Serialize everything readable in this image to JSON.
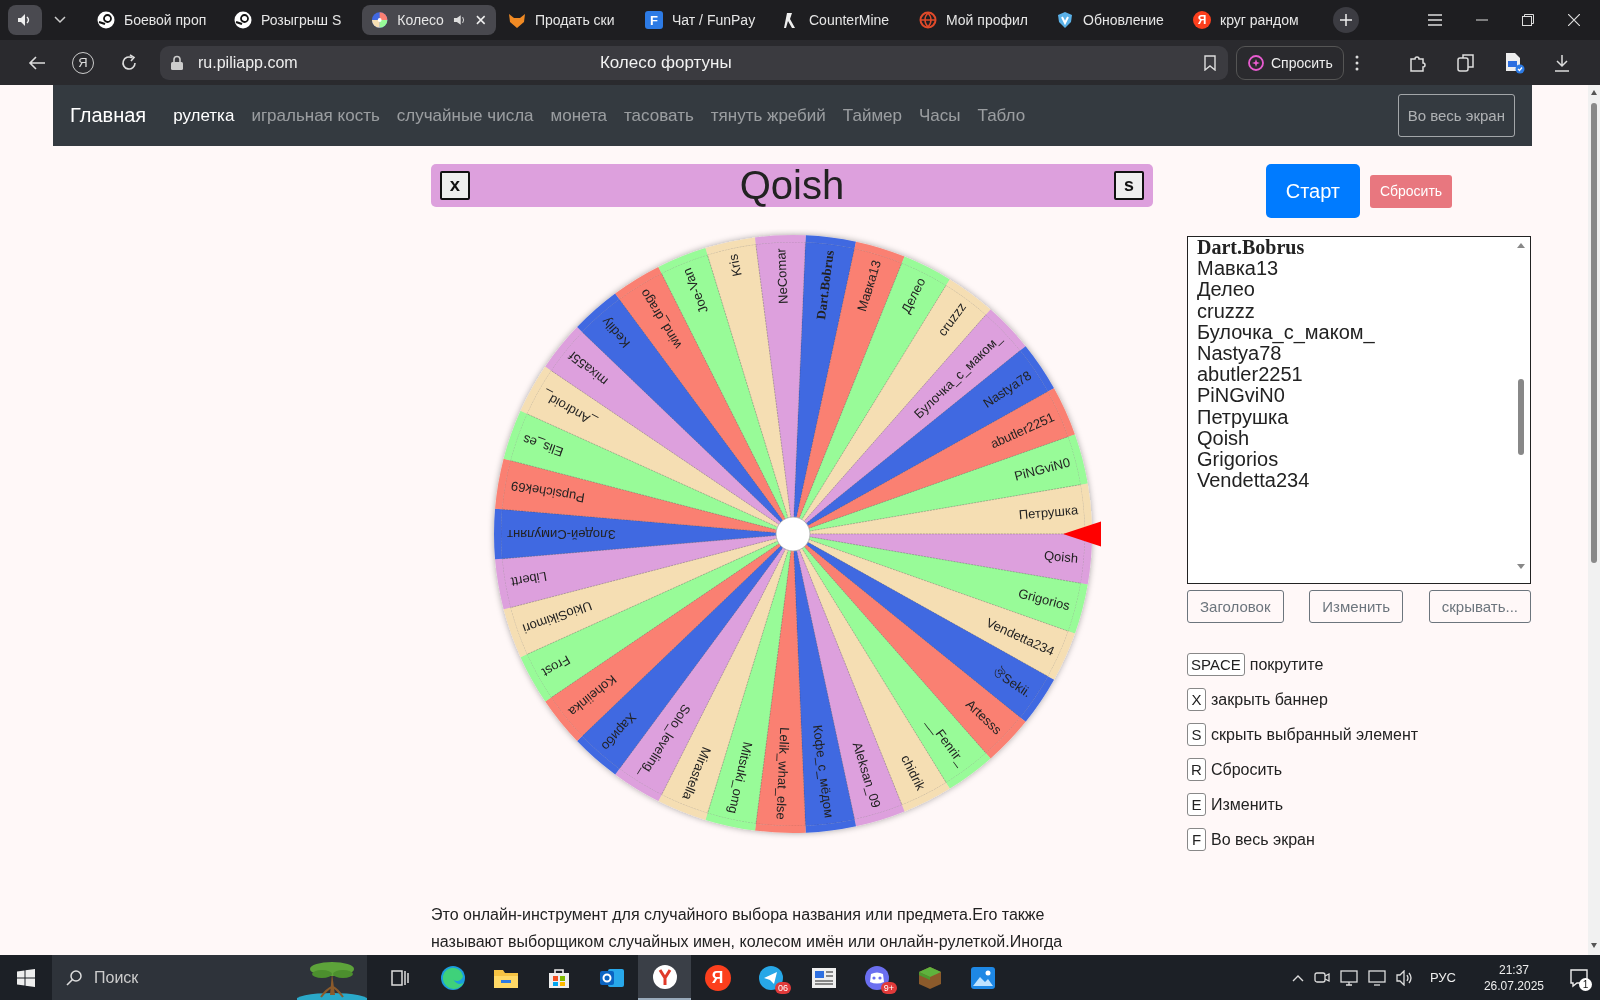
{
  "browser": {
    "tabs": [
      {
        "title": "Боевой проп",
        "kind": "steam",
        "selected": false
      },
      {
        "title": "Розыгрыш S",
        "kind": "steam",
        "selected": false
      },
      {
        "title": "Колесо",
        "kind": "wheel",
        "selected": true
      },
      {
        "title": "Продать ски",
        "kind": "fox",
        "selected": false
      },
      {
        "title": "Чат / FunPay",
        "kind": "letter",
        "icon_text": "F",
        "selected": false
      },
      {
        "title": "CounterMine",
        "kind": "counter",
        "selected": false
      },
      {
        "title": "Мой профил",
        "kind": "globe",
        "selected": false
      },
      {
        "title": "Обновление",
        "kind": "shield",
        "selected": false
      },
      {
        "title": "круг рандом",
        "kind": "letter-round",
        "icon_text": "Я",
        "selected": false
      }
    ],
    "yandex_button": "Я",
    "url": "ru.piliapp.com",
    "page_title": "Колесо фортуны",
    "ask_button": "Спросить"
  },
  "nav": {
    "brand": "Главная",
    "items": [
      {
        "label": "рулетка",
        "selected": true
      },
      {
        "label": "игральная кость",
        "selected": false
      },
      {
        "label": "случайные числа",
        "selected": false
      },
      {
        "label": "монета",
        "selected": false
      },
      {
        "label": "тасовать",
        "selected": false
      },
      {
        "label": "тянуть жребий",
        "selected": false
      },
      {
        "label": "Таймер",
        "selected": false
      },
      {
        "label": "Часы",
        "selected": false
      },
      {
        "label": "Табло",
        "selected": false
      }
    ],
    "fullscreen_button": "Во весь экран"
  },
  "banner": {
    "close_key": "x",
    "title": "Qoish",
    "hide_key": "s"
  },
  "wheel": {
    "segments": [
      {
        "label": "Dart.Bobrus",
        "color": "#4169e1",
        "bold": true
      },
      {
        "label": "Мавка13",
        "color": "#fa8072",
        "bold": false
      },
      {
        "label": "Делео",
        "color": "#98fb98",
        "bold": false
      },
      {
        "label": "cruzzz",
        "color": "#f5deb3",
        "bold": false
      },
      {
        "label": "Булочка_с_маком_",
        "color": "#dda0dd",
        "bold": false
      },
      {
        "label": "Nastya78",
        "color": "#4169e1",
        "bold": false
      },
      {
        "label": "abutler2251",
        "color": "#fa8072",
        "bold": false
      },
      {
        "label": "PiNGviN0",
        "color": "#98fb98",
        "bold": false
      },
      {
        "label": "Петрушка",
        "color": "#f5deb3",
        "bold": false
      },
      {
        "label": "Qoish",
        "color": "#dda0dd",
        "bold": false
      },
      {
        "label": "Grigorios",
        "color": "#98fb98",
        "bold": false
      },
      {
        "label": "Vendetta234",
        "color": "#f5deb3",
        "bold": false
      },
      {
        "label": "ঔSekii.",
        "color": "#4169e1",
        "bold": false
      },
      {
        "label": "Artesss",
        "color": "#fa8072",
        "bold": false
      },
      {
        "label": "__Fenrir_",
        "color": "#98fb98",
        "bold": false
      },
      {
        "label": "chidrik",
        "color": "#f5deb3",
        "bold": false
      },
      {
        "label": "Aleksan_09",
        "color": "#dda0dd",
        "bold": false
      },
      {
        "label": "Кофе_с_мёдом",
        "color": "#4169e1",
        "bold": false
      },
      {
        "label": "Lelik_what_else",
        "color": "#fa8072",
        "bold": false
      },
      {
        "label": "Mitsuki_omg",
        "color": "#98fb98",
        "bold": false
      },
      {
        "label": "Mirastella",
        "color": "#f5deb3",
        "bold": false
      },
      {
        "label": "Solo_leveling_",
        "color": "#dda0dd",
        "bold": false
      },
      {
        "label": "Харибо",
        "color": "#4169e1",
        "bold": false
      },
      {
        "label": "Koheiinka",
        "color": "#fa8072",
        "bold": false
      },
      {
        "label": "Frost",
        "color": "#98fb98",
        "bold": false
      },
      {
        "label": "UkioSikimori",
        "color": "#f5deb3",
        "bold": false
      },
      {
        "label": "Libertt",
        "color": "#dda0dd",
        "bold": false
      },
      {
        "label": "Злодей-Симулянт",
        "color": "#4169e1",
        "bold": false
      },
      {
        "label": "Pupsichek69",
        "color": "#fa8072",
        "bold": false
      },
      {
        "label": "Elis_es",
        "color": "#98fb98",
        "bold": false
      },
      {
        "label": "_Android_",
        "color": "#f5deb3",
        "bold": false
      },
      {
        "label": "mixa55f",
        "color": "#dda0dd",
        "bold": false
      },
      {
        "label": "Kedily",
        "color": "#4169e1",
        "bold": false
      },
      {
        "label": "wind_drago",
        "color": "#fa8072",
        "bold": false
      },
      {
        "label": "Joe-Van",
        "color": "#98fb98",
        "bold": false
      },
      {
        "label": "Kris",
        "color": "#f5deb3",
        "bold": false
      },
      {
        "label": "NeComar",
        "color": "#dda0dd",
        "bold": false
      }
    ]
  },
  "controls": {
    "start_button": "Старт",
    "reset_button": "Сбросить"
  },
  "entries": [
    "Dart.Bobrus",
    "Мавка13",
    "Делео",
    "cruzzz",
    "Булочка_с_маком_",
    "Nastya78",
    "abutler2251",
    "PiNGviN0",
    "Петрушка",
    "Qoish",
    "Grigorios",
    "Vendetta234"
  ],
  "entry_buttons": [
    "Заголовок",
    "Изменить",
    "скрывать..."
  ],
  "shortcuts": [
    {
      "key": "SPACE",
      "label": "покрутите"
    },
    {
      "key": "X",
      "label": "закрыть баннер"
    },
    {
      "key": "S",
      "label": "скрыть выбранный элемент"
    },
    {
      "key": "R",
      "label": "Сбросить"
    },
    {
      "key": "E",
      "label": "Изменить"
    },
    {
      "key": "F",
      "label": "Во весь экран"
    }
  ],
  "description": "Это онлайн-инструмент для случайного выбора названия или предмета.Его также называют выборщиком случайных имен, колесом имён или онлайн-рулеткой.Иногда",
  "taskbar": {
    "search_placeholder": "Поиск",
    "apps": [
      {
        "kind": "taskview",
        "selected": false
      },
      {
        "kind": "edge",
        "selected": false
      },
      {
        "kind": "explorer",
        "selected": false
      },
      {
        "kind": "store",
        "selected": false
      },
      {
        "kind": "outlook",
        "selected": false
      },
      {
        "kind": "yandex-browser",
        "selected": true
      },
      {
        "kind": "yandex",
        "icon_text": "Я",
        "selected": false
      },
      {
        "kind": "telegram",
        "badge": "06",
        "selected": false
      },
      {
        "kind": "news",
        "selected": false
      },
      {
        "kind": "discord",
        "badge": "9+",
        "selected": false
      },
      {
        "kind": "minecraft",
        "selected": false
      },
      {
        "kind": "photos",
        "selected": false
      }
    ],
    "language": "РУС",
    "time": "21:37",
    "date": "26.07.2025",
    "notifications": "1"
  }
}
